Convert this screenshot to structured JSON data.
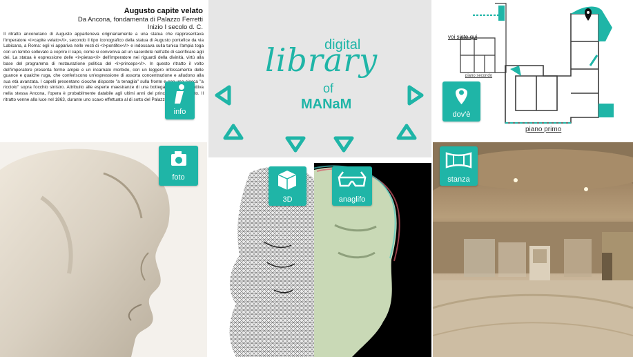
{
  "text_panel": {
    "title": "Augusto capite velato",
    "origin": "Da Ancona, fondamenta di Palazzo Ferretti",
    "date": "Inizio I secolo d. C.",
    "body": "Il ritratto anconetano di Augusto apparteneva originariamente a una statua che rappresentava l'imperatore <i>capite velato</i>, secondo il tipo iconografico della statua di Augusto pontefice da via Labicana, a Roma: egli vi appariva nelle vesti di <i>pontifex</i> e indossava sulla tunica l'ampia toga con un lembo sollevato a coprire il capo, come si conveniva ad un sacerdote nell'atto di sacrificare agli dei. La statua è espressione delle <i>pietas</i> dell'imperatore nei riguardi della divinità, virtù alla base del programma di restaurazione politica del <i>princeps</i>. In questo ritratto il volto dell'imperatore presenta forme ampie e un incarnato morbido, con un leggero infossamento delle guance e qualche ruga, che conferiscono un'espressione di assorta concentrazione e alludono alla sua età avanzata. I capelli presentano ciocche disposte \"a tenaglia\" sulla fronte e con una ciocca \"a ricciolo\" sopra l'occhio sinistro. Attribuito alle esperte maestranze di una bottega locale, forse attiva nella stessa Ancona, l'opera è probabilmente databile agli ultimi anni del principato di Augusto. Il ritratto venne alla luce nel 1863, durante uno scavo effettuato al di sotto del Palazzo Ferretti."
  },
  "title_panel": {
    "word1": "digital",
    "word2": "library",
    "word3": "of",
    "word4": "MANaM"
  },
  "buttons": {
    "info": "info",
    "foto": "foto",
    "model3d": "3D",
    "anaglifo": "anaglifo",
    "dove": "dov'è",
    "stanza": "stanza"
  },
  "map": {
    "you_are_here": "voi siete qui",
    "floor2": "piano secondo",
    "floor1": "piano primo"
  },
  "colors": {
    "accent": "#1fb5a7",
    "title_bg": "#e6e6e6"
  }
}
